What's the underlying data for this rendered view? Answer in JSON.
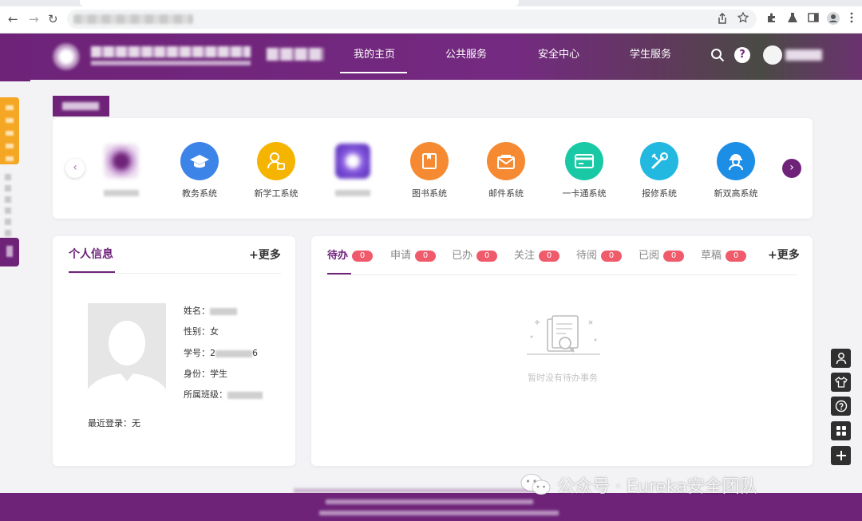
{
  "browser": {
    "back": "←",
    "forward": "→",
    "reload": "↻",
    "icons": [
      "share-icon",
      "star-icon",
      "extensions-icon",
      "lab-icon",
      "sidepanel-icon",
      "profile-icon",
      "menu-icon"
    ]
  },
  "header": {
    "nav": [
      {
        "label": "我的主页",
        "active": true
      },
      {
        "label": "公共服务",
        "active": false
      },
      {
        "label": "安全中心",
        "active": false
      },
      {
        "label": "学生服务",
        "active": false
      }
    ],
    "help": "?"
  },
  "apps": {
    "prev": "‹",
    "next": "›",
    "items": [
      {
        "label": "",
        "color": "#b06fc0",
        "icon": "blurred-app-icon"
      },
      {
        "label": "教务系统",
        "color": "#3d84e8",
        "icon": "graduation-cap-icon"
      },
      {
        "label": "新学工系统",
        "color": "#f5b400",
        "icon": "user-badge-icon"
      },
      {
        "label": "",
        "color": "#8a5de0",
        "icon": "blurred-app-icon"
      },
      {
        "label": "图书系统",
        "color": "#f58a32",
        "icon": "book-icon"
      },
      {
        "label": "邮件系统",
        "color": "#f58a32",
        "icon": "mail-icon"
      },
      {
        "label": "一卡通系统",
        "color": "#19c9a6",
        "icon": "card-icon"
      },
      {
        "label": "报修系统",
        "color": "#22b8e0",
        "icon": "wrench-icon"
      },
      {
        "label": "新双高系统",
        "color": "#1d8ee6",
        "icon": "worker-icon"
      }
    ]
  },
  "personal": {
    "title": "个人信息",
    "more": "+更多",
    "fields": [
      {
        "label": "姓名：",
        "value": ""
      },
      {
        "label": "性别：",
        "value": "女"
      },
      {
        "label": "学号：",
        "value": "2",
        "suffix": "6"
      },
      {
        "label": "身份：",
        "value": "学生"
      },
      {
        "label": "所属班级：",
        "value": ""
      }
    ],
    "last_login_label": "最近登录：",
    "last_login_value": "无"
  },
  "todo": {
    "more": "+更多",
    "tabs": [
      {
        "label": "待办",
        "count": "0",
        "active": true
      },
      {
        "label": "申请",
        "count": "0"
      },
      {
        "label": "已办",
        "count": "0"
      },
      {
        "label": "关注",
        "count": "0"
      },
      {
        "label": "待阅",
        "count": "0"
      },
      {
        "label": "已阅",
        "count": "0"
      },
      {
        "label": "草稿",
        "count": "0"
      }
    ],
    "empty_text": "暂时没有待办事务"
  },
  "toolbar": [
    "person-icon",
    "shirt-icon",
    "help-circle-icon",
    "grid-icon",
    "plus-icon"
  ],
  "watermark": "公众号 · Eureka安全团队",
  "colors": {
    "primary": "#6e2379",
    "badge": "#f05b6b",
    "accent_orange": "#f5a623"
  }
}
